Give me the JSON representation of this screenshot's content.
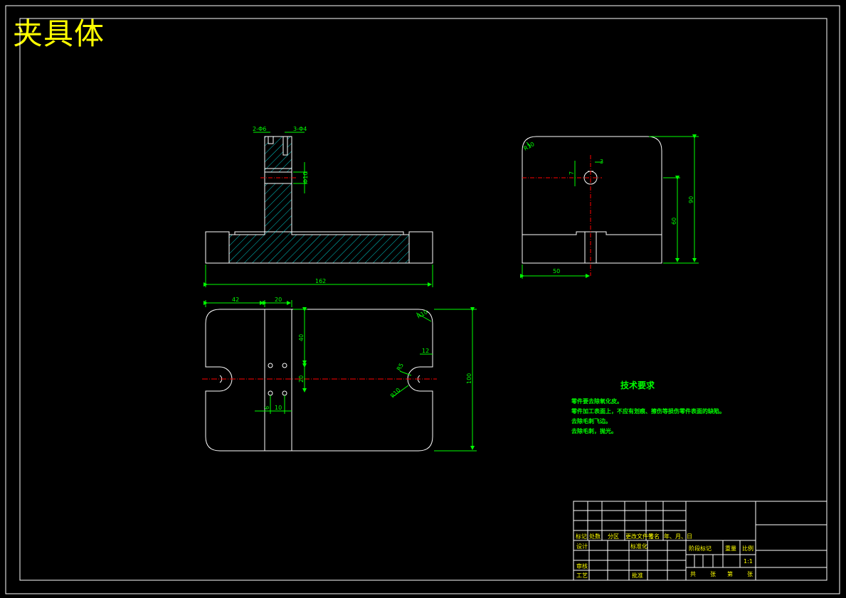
{
  "title": "夹具体",
  "dimensions": {
    "front_top_left": "2-Φ6",
    "front_top_right": "3-Φ4",
    "front_height": "Φ10",
    "front_width": "162",
    "side_radius": "R10",
    "side_small": "3",
    "side_left": "7",
    "side_center_height": "60",
    "side_total_height": "90",
    "side_width": "50",
    "plan_left": "42",
    "plan_mid": "20",
    "plan_radius": "R10",
    "plan_right": "12",
    "plan_upper_v": "40",
    "plan_lower_v": "20",
    "plan_hole_h1": "6",
    "plan_hole_h2": "10",
    "plan_slot_r1": "R5",
    "plan_slot_r2": "R10",
    "plan_total_v": "100"
  },
  "technical_requirements": {
    "title": "技术要求",
    "items": [
      "零件要去除氧化皮。",
      "零件加工表面上，不应有划痕、擦伤等损伤零件表面的缺陷。",
      "去除毛刺飞边。",
      "去除毛刺，抛光。"
    ]
  },
  "title_block": {
    "header_labels": [
      "标记",
      "处数",
      "分区",
      "更改文件号",
      "签名",
      "年、月、日"
    ],
    "design": "设计",
    "standardization": "标准化",
    "review": "审核",
    "process": "工艺",
    "approve": "批准",
    "stage_mark": "阶段标记",
    "weight": "重量",
    "scale": "比例",
    "scale_value": "1:1",
    "sheets": [
      "共",
      "张",
      "第",
      "张"
    ]
  },
  "colors": {
    "outline": "#ffffff",
    "dimension": "#00ff00",
    "hatch": "#00ffff",
    "centerline": "#ff0000",
    "title_text": "#ffff00"
  }
}
